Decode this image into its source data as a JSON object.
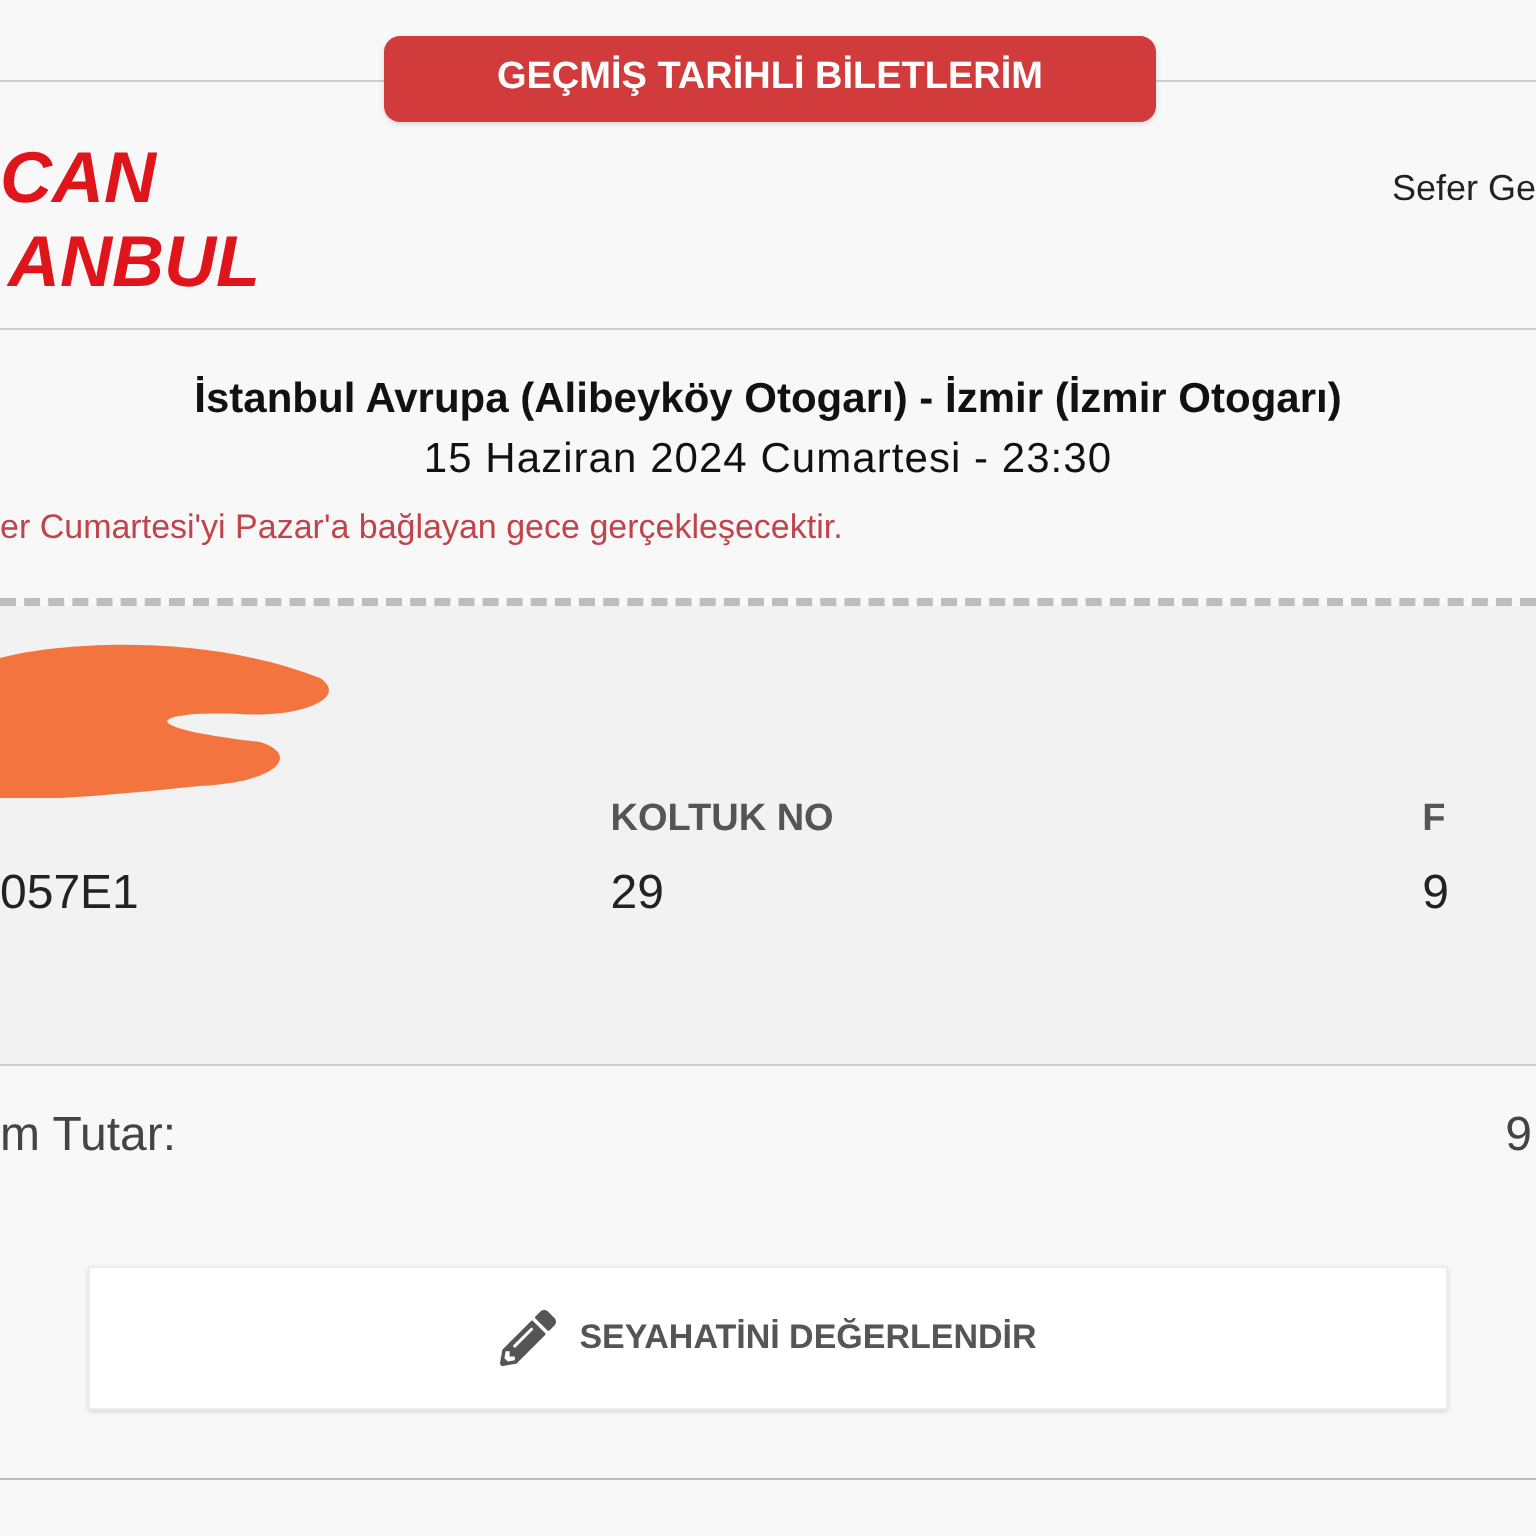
{
  "header_badge": "GEÇMİŞ TARİHLİ BİLETLERİM",
  "logo": {
    "line_1": "CAN",
    "line_2": "ANBUL"
  },
  "top_right_text": "Sefer Ge",
  "trip": {
    "route": "İstanbul Avrupa (Alibeyköy Otogarı) - İzmir (İzmir Otogarı)",
    "date": "15 Haziran 2024 Cumartesi - 23:30",
    "note": "er Cumartesi'yi Pazar'a bağlayan gece gerçekleşecektir."
  },
  "details": [
    {
      "value": "057E1"
    },
    {
      "label": "KOLTUK NO",
      "value": "29"
    },
    {
      "label": "F",
      "value": "9"
    }
  ],
  "total": {
    "label": "m Tutar:",
    "value": "9"
  },
  "rate_button": "SEYAHATİNİ DEĞERLENDİR"
}
